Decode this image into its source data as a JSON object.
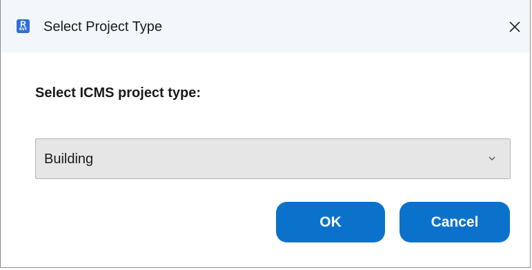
{
  "window": {
    "title": "Select Project Type",
    "app_icon": {
      "letter": "R",
      "sub": "RVT"
    }
  },
  "close_icon": "close-icon",
  "form": {
    "prompt": "Select ICMS project type:",
    "project_type": {
      "selected": "Building"
    }
  },
  "buttons": {
    "ok_label": "OK",
    "cancel_label": "Cancel"
  },
  "colors": {
    "accent": "#0b72cc",
    "titlebar": "#f3f6fb",
    "dropdown_bg": "#e6e6e6",
    "app_icon": "#2f6fd6"
  }
}
